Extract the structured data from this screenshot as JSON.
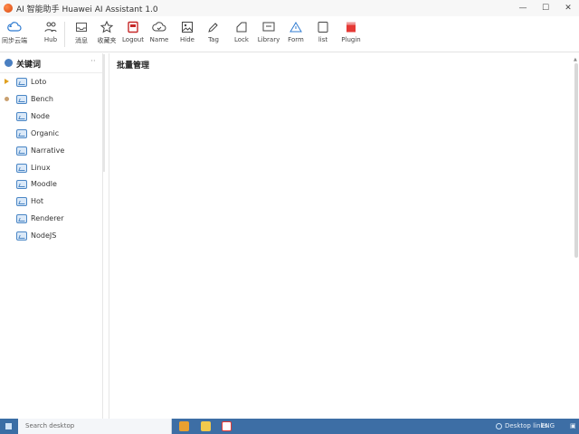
{
  "window": {
    "title": "AI 智能助手   Huawei AI Assistant  1.0",
    "controls": {
      "minimize": "—",
      "maximize": "☐",
      "close": "✕"
    }
  },
  "toolbar": {
    "items": [
      {
        "label": "同步云端",
        "icon": "cloud-sync-icon"
      },
      {
        "label": "Hub",
        "icon": "people-icon"
      },
      {
        "label": "消息",
        "icon": "inbox-icon"
      },
      {
        "label": "收藏夹",
        "icon": "star-icon"
      },
      {
        "label": "Logout",
        "icon": "logout-icon"
      },
      {
        "label": "Name",
        "icon": "cloud-check-icon"
      },
      {
        "label": "Hide",
        "icon": "picture-icon"
      },
      {
        "label": "Tag",
        "icon": "pen-icon"
      },
      {
        "label": "Lock",
        "icon": "note-icon"
      },
      {
        "label": "Library",
        "icon": "monitor-icon"
      },
      {
        "label": "Form",
        "icon": "warning-cloud-icon"
      },
      {
        "label": "list",
        "icon": "square-icon"
      },
      {
        "label": "Plugin",
        "icon": "red-box-icon"
      }
    ]
  },
  "tree": {
    "title": "关键词",
    "more": "··",
    "items": [
      {
        "label": "Loto",
        "marker": "arrow"
      },
      {
        "label": "Bench",
        "marker": "dot"
      },
      {
        "label": "Node",
        "marker": "none"
      },
      {
        "label": "Organic",
        "marker": "none"
      },
      {
        "label": "Narrative",
        "marker": "none"
      },
      {
        "label": "Linux",
        "marker": "none"
      },
      {
        "label": "Moodle",
        "marker": "none"
      },
      {
        "label": "Hot",
        "marker": "none"
      },
      {
        "label": "Renderer",
        "marker": "none"
      },
      {
        "label": "NodeJS",
        "marker": "none"
      }
    ]
  },
  "content": {
    "title": "批量管理"
  },
  "taskbar": {
    "search_placeholder": "Search desktop",
    "tray_text": "Desktop links",
    "tray_text2": "ENG",
    "notify": "▣"
  },
  "colors": {
    "accent": "#3d6ea5",
    "folder": "#4a86c5"
  }
}
